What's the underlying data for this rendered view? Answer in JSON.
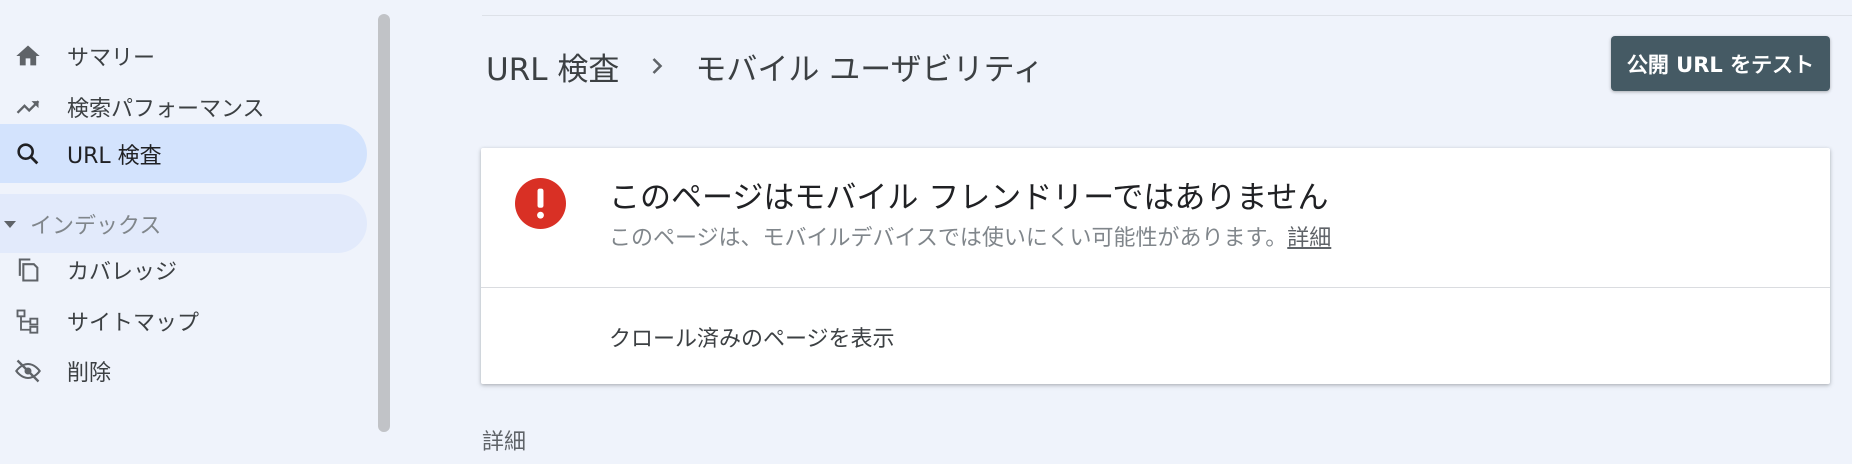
{
  "sidebar": {
    "items": [
      {
        "label": "サマリー",
        "icon": "home-icon"
      },
      {
        "label": "検索パフォーマンス",
        "icon": "trending-up-icon"
      },
      {
        "label": "URL 検査",
        "icon": "search-icon",
        "active": true
      },
      {
        "label": "インデックス",
        "icon": "caret-down-icon",
        "section": true
      },
      {
        "label": "カバレッジ",
        "icon": "copy-icon"
      },
      {
        "label": "サイトマップ",
        "icon": "sitemap-icon"
      },
      {
        "label": "削除",
        "icon": "visibility-off-icon"
      }
    ]
  },
  "header": {
    "breadcrumb": [
      "URL 検査",
      "モバイル ユーザビリティ"
    ],
    "test_button_label": "公開 URL をテスト"
  },
  "card": {
    "title": "このページはモバイル フレンドリーではありません",
    "subtitle": "このページは、モバイルデバイスでは使いにくい可能性があります。",
    "subtitle_link": "詳細",
    "action_label": "クロール済みのページを表示",
    "status_icon": "error-icon"
  },
  "details": {
    "heading": "詳細"
  },
  "colors": {
    "background": "#eff3fb",
    "active_nav": "#d3e3fd",
    "button": "#455a64",
    "error": "#d93025"
  }
}
